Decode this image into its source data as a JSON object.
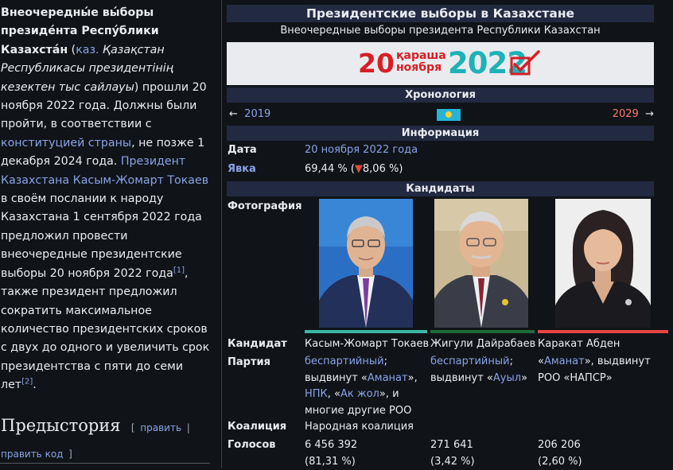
{
  "article": {
    "title_bold": "Внеочередны́е вы́боры президе́нта Респу́блики Казахста́н",
    "kaz_open": " (",
    "kaz_label": "каз.",
    "kaz_text": " Қазақстан Республикасы президентінің кезектен тыс сайлауы",
    "p1": ") прошли 20 ноября 2022 года. Должны были пройти, в соответствии с ",
    "link_constitution": "конституцией страны",
    "p2": ", не позже 1 декабря 2024 года. ",
    "link_president": "Президент Казахстана Касым-Жомарт Токаев",
    "p3": " в своём послании к народу Казахстана 1 сентября 2022 года предложил провести внеочередные президентские выборы 20 ноября 2022 года",
    "ref1": "[1]",
    "p4": ", также президент предложил сократить максимальное количество президентских сроков с двух до одного и увеличить срок президентства с пяти до семи лет",
    "ref2": "[2]",
    "p5": ".",
    "section_title": "Предыстория",
    "edit_open": "[",
    "edit_label": "править",
    "edit_sep": "|",
    "edit_code": "править код",
    "edit_close": "]"
  },
  "infobox": {
    "title": "Президентские выборы в Казахстане",
    "subtitle": "Внеочередные выборы президента Республики Казахстан",
    "logo": {
      "day": "20",
      "month_top": "қараша",
      "month_bottom": "ноября",
      "year": "2022"
    },
    "chronology_header": "Хронология",
    "prev_arrow": "←",
    "prev_year": "2019",
    "next_year": "2029",
    "next_arrow": "→",
    "info_header": "Информация",
    "date_label": "Дата",
    "date_value": "20 ноября 2022 года",
    "turnout_label": "Явка",
    "turnout_value": "69,44 % (",
    "turnout_change_icon": "▼",
    "turnout_change": "8,06 %)",
    "candidates_header": "Кандидаты",
    "photo_label": "Фотография",
    "candidate_label": "Кандидат",
    "party_label": "Партия",
    "coalition_label": "Коалиция",
    "votes_label": "Голосов",
    "candidates": [
      {
        "name": "Касым-Жомарт Токаев",
        "party_1": "беспартийный",
        "party_2": ";",
        "party_3": "выдвинут «",
        "party_4": "Аманат",
        "party_5": "»,",
        "party_6": "НПК",
        "party_7": ", «",
        "party_8": "Ак жол",
        "party_9": "», и",
        "party_10": "многие другие РОО",
        "coalition": "Народная коалиция",
        "votes": "6 456 392",
        "percent": "(81,31 %)",
        "color": "#3cb8a5"
      },
      {
        "name": "Жигули Дайрабаев",
        "party_1": "беспартийный",
        "party_2": ";",
        "party_3": "выдвинут «",
        "party_4": "Ауыл",
        "party_5": "»",
        "votes": "271 641",
        "percent": "(3,42 %)",
        "color": "#1f6b3a"
      },
      {
        "name": "Каракат Абден",
        "party_1": "«",
        "party_2": "Аманат",
        "party_3": "», выдвинут",
        "party_4": "РОО «НАПСР»",
        "votes": "206 206",
        "percent": "(2,60 %)",
        "color": "#e84444"
      }
    ]
  }
}
